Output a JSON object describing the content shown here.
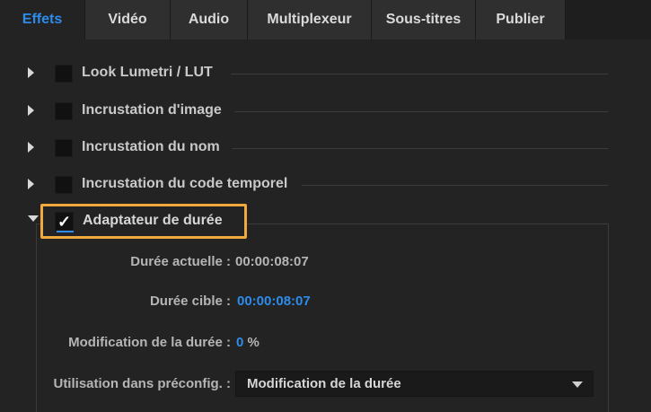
{
  "tabs": [
    {
      "label": "Effets",
      "active": true
    },
    {
      "label": "Vidéo",
      "active": false
    },
    {
      "label": "Audio",
      "active": false
    },
    {
      "label": "Multiplexeur",
      "active": false
    },
    {
      "label": "Sous-titres",
      "active": false
    },
    {
      "label": "Publier",
      "active": false
    }
  ],
  "effects": [
    {
      "label": "Look Lumetri / LUT",
      "checked": false,
      "expanded": false
    },
    {
      "label": "Incrustation d'image",
      "checked": false,
      "expanded": false
    },
    {
      "label": "Incrustation du nom",
      "checked": false,
      "expanded": false
    },
    {
      "label": "Incrustation du code temporel",
      "checked": false,
      "expanded": false
    },
    {
      "label": "Adaptateur de durée",
      "checked": true,
      "expanded": true
    }
  ],
  "duration_adapter": {
    "current_duration_label": "Durée actuelle :",
    "current_duration_value": "00:00:08:07",
    "target_duration_label": "Durée cible :",
    "target_duration_value": "00:00:08:07",
    "modification_label": "Modification de la durée :",
    "modification_value": "0",
    "modification_unit": "%",
    "preset_usage_label": "Utilisation dans préconfig. :",
    "preset_usage_selected": "Modification de la durée"
  },
  "colors": {
    "accent": "#2d8ceb",
    "highlight": "#f0a93c",
    "background": "#232323"
  },
  "icons": {
    "collapsed": "triangle-right-icon",
    "expanded": "triangle-down-icon",
    "dropdown": "chevron-down-icon",
    "check": "checkmark-icon"
  }
}
